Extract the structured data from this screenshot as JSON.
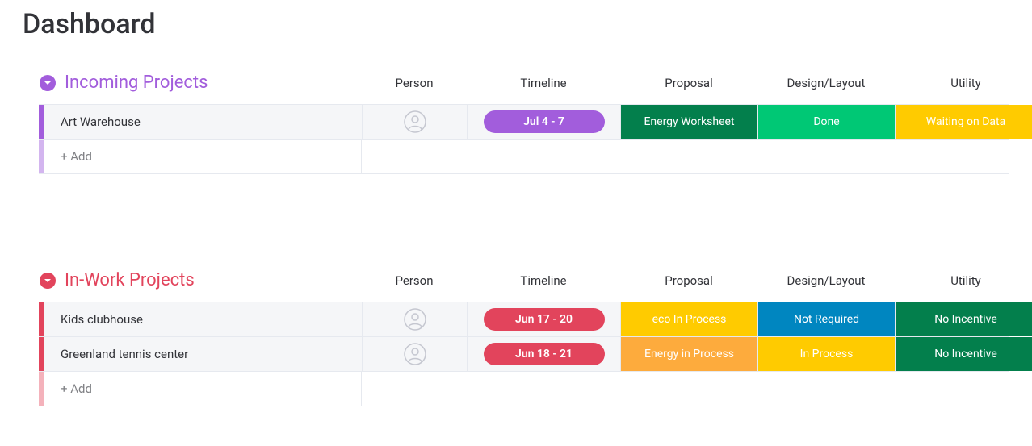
{
  "page_title": "Dashboard",
  "columns": {
    "person": "Person",
    "timeline": "Timeline",
    "proposal": "Proposal",
    "design": "Design/Layout",
    "utility": "Utility"
  },
  "groups": [
    {
      "id": "incoming",
      "title": "Incoming Projects",
      "color": "#a25ddc",
      "chevron_fill": "#a25ddc",
      "items": [
        {
          "name": "Art Warehouse",
          "timeline_label": "Jul 4 - 7",
          "timeline_color": "#a25ddc",
          "proposal": {
            "label": "Energy Worksheet",
            "color": "#037f4c"
          },
          "design": {
            "label": "Done",
            "color": "#00c875"
          },
          "utility": {
            "label": "Waiting on Data",
            "color": "#ffcb00"
          }
        }
      ],
      "add_label": "+ Add",
      "add_indicator_color": "#d3b5ef"
    },
    {
      "id": "inwork",
      "title": "In-Work Projects",
      "color": "#e2445c",
      "chevron_fill": "#e2445c",
      "items": [
        {
          "name": "Kids clubhouse",
          "timeline_label": "Jun 17 - 20",
          "timeline_color": "#e2445c",
          "proposal": {
            "label": "eco In Process",
            "color": "#ffcb00"
          },
          "design": {
            "label": "Not Required",
            "color": "#0086c0"
          },
          "utility": {
            "label": "No Incentive",
            "color": "#037f4c"
          }
        },
        {
          "name": "Greenland tennis center",
          "timeline_label": "Jun 18 - 21",
          "timeline_color": "#e2445c",
          "proposal": {
            "label": "Energy in Process",
            "color": "#fdab3d"
          },
          "design": {
            "label": "In Process",
            "color": "#ffcb00"
          },
          "utility": {
            "label": "No Incentive",
            "color": "#037f4c"
          }
        }
      ],
      "add_label": "+ Add",
      "add_indicator_color": "#f4b2bb"
    }
  ]
}
